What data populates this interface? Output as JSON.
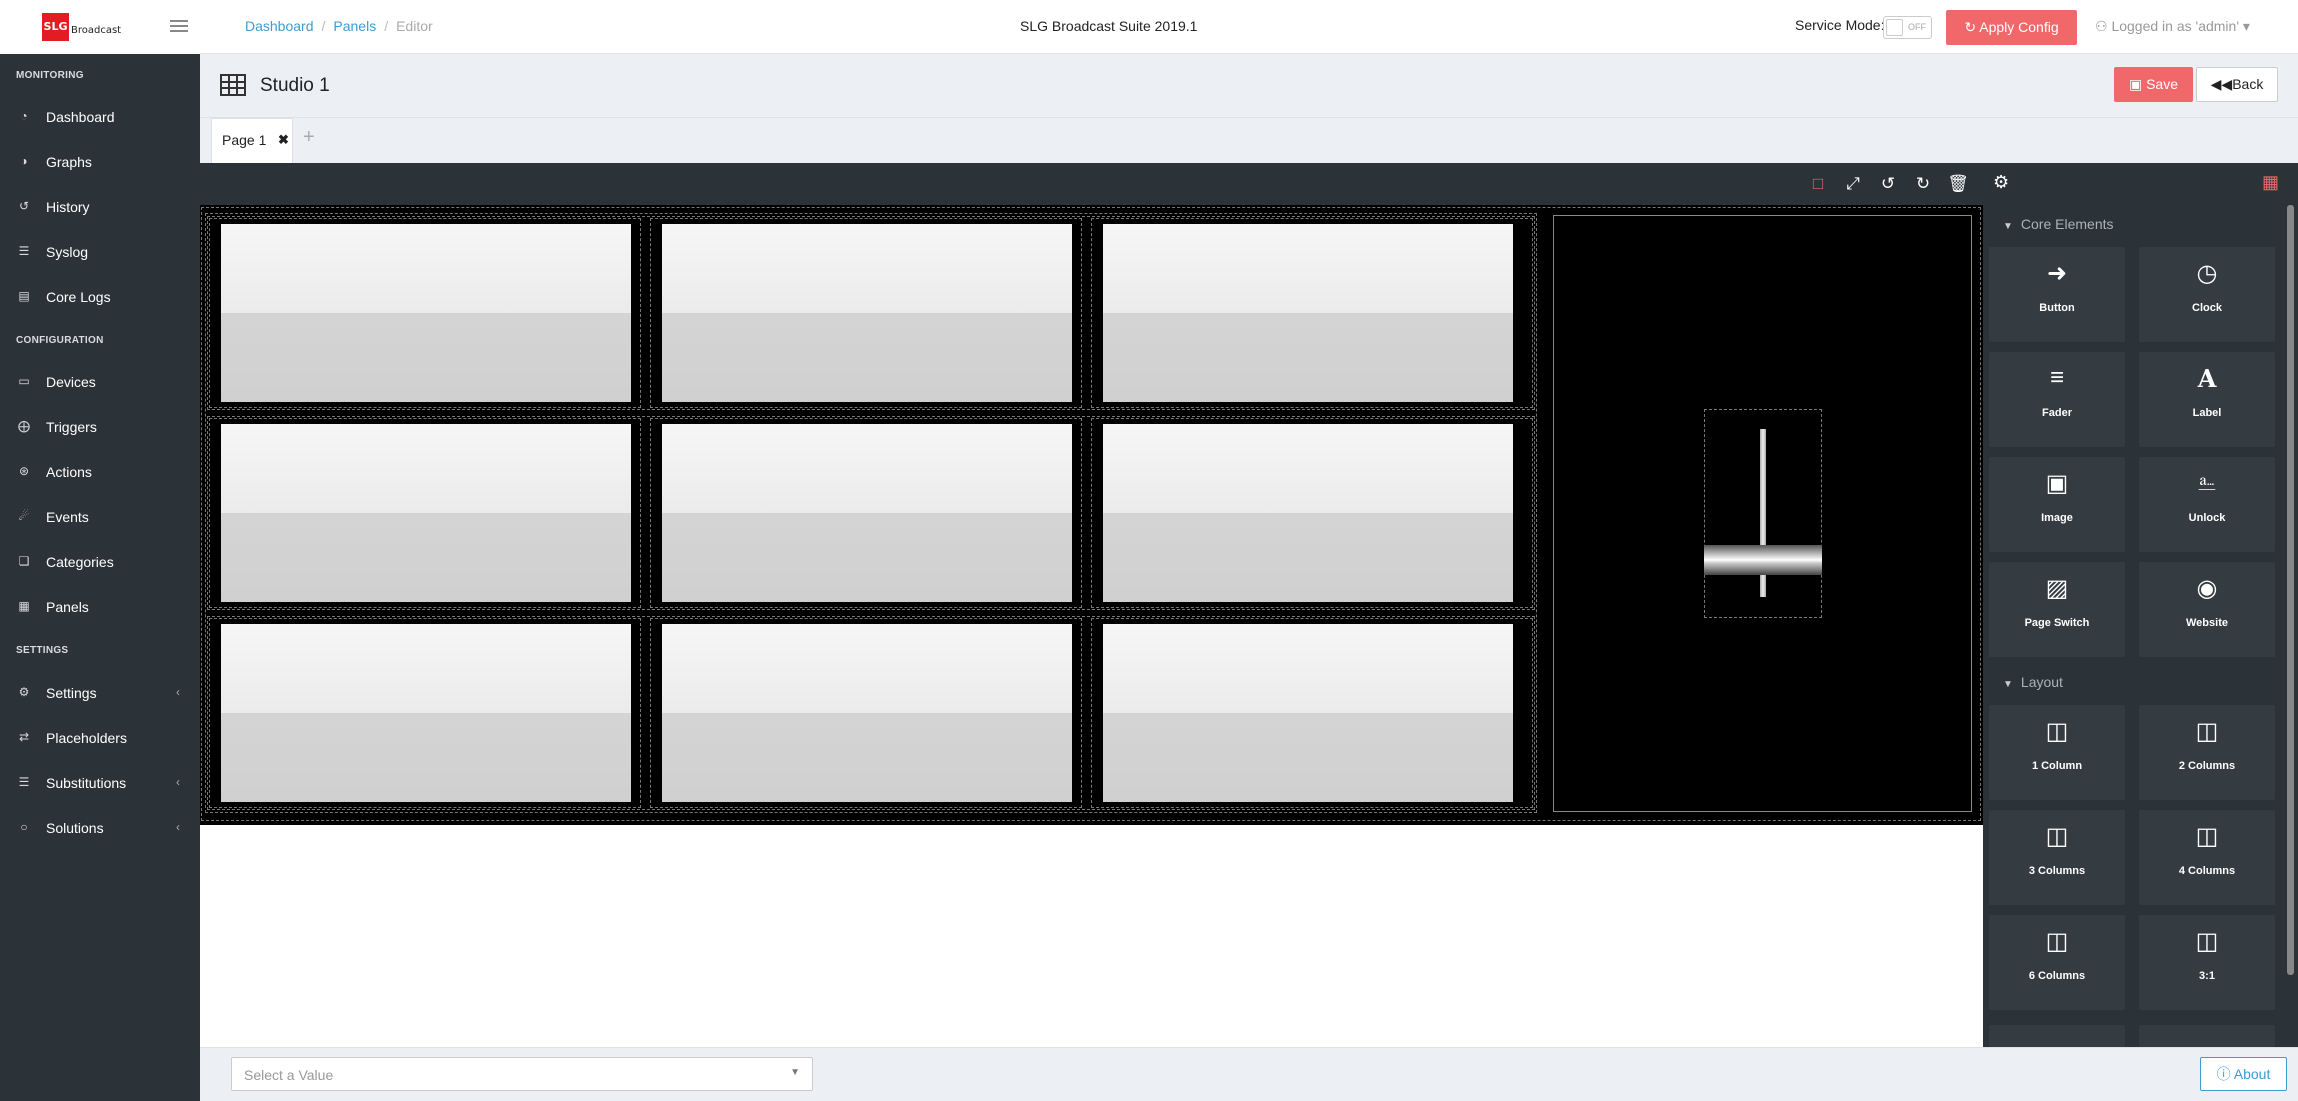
{
  "topbar": {
    "logo_badge": "SLG",
    "logo_word": "Broadcast",
    "breadcrumb": [
      "Dashboard",
      "Panels",
      "Editor"
    ],
    "app_title": "SLG Broadcast Suite 2019.1",
    "service_mode_label": "Service Mode:",
    "service_mode_state": "OFF",
    "apply_config": "Apply Config",
    "user": "Logged in as 'admin'"
  },
  "sidebar": {
    "sections": [
      "MONITORING",
      "CONFIGURATION",
      "SETTINGS"
    ],
    "monitoring": [
      {
        "label": "Dashboard",
        "icon": "dashboard-icon"
      },
      {
        "label": "Graphs",
        "icon": "pie-chart-icon"
      },
      {
        "label": "History",
        "icon": "history-icon"
      },
      {
        "label": "Syslog",
        "icon": "database-icon"
      },
      {
        "label": "Core Logs",
        "icon": "file-icon"
      }
    ],
    "configuration": [
      {
        "label": "Devices",
        "icon": "monitor-icon"
      },
      {
        "label": "Triggers",
        "icon": "crosshair-icon"
      },
      {
        "label": "Actions",
        "icon": "broadcast-icon"
      },
      {
        "label": "Events",
        "icon": "bell-icon"
      },
      {
        "label": "Categories",
        "icon": "cubes-icon"
      },
      {
        "label": "Panels",
        "icon": "grid-icon"
      }
    ],
    "settings": [
      {
        "label": "Settings",
        "icon": "gear-icon",
        "has_children": true
      },
      {
        "label": "Placeholders",
        "icon": "swap-icon",
        "has_children": false
      },
      {
        "label": "Substitutions",
        "icon": "layers-icon",
        "has_children": true
      },
      {
        "label": "Solutions",
        "icon": "lightbulb-icon",
        "has_children": true
      }
    ]
  },
  "header": {
    "title": "Studio 1",
    "save": "Save",
    "back": "Back"
  },
  "tabs": [
    {
      "label": "Page 1"
    }
  ],
  "right_panel": {
    "core_title": "Core Elements",
    "core": [
      {
        "label": "Button",
        "icon": "sign-in-icon"
      },
      {
        "label": "Clock",
        "icon": "clock-icon"
      },
      {
        "label": "Fader",
        "icon": "sliders-icon"
      },
      {
        "label": "Label",
        "icon": "font-icon"
      },
      {
        "label": "Image",
        "icon": "image-icon"
      },
      {
        "label": "Unlock",
        "icon": "unlock-icon"
      },
      {
        "label": "Page Switch",
        "icon": "sticky-note-icon"
      },
      {
        "label": "Website",
        "icon": "globe-icon"
      }
    ],
    "layout_title": "Layout",
    "layout": [
      {
        "label": "1 Column",
        "icon": "columns-icon"
      },
      {
        "label": "2 Columns",
        "icon": "columns-icon"
      },
      {
        "label": "3 Columns",
        "icon": "columns-icon"
      },
      {
        "label": "4 Columns",
        "icon": "columns-icon"
      },
      {
        "label": "6 Columns",
        "icon": "columns-icon"
      },
      {
        "label": "3:1",
        "icon": "columns-icon"
      }
    ]
  },
  "footer": {
    "select_placeholder": "Select a Value",
    "about": "About"
  },
  "colors": {
    "accent": "#f0686a",
    "link": "#3c9dd1",
    "sidebar": "#2c3338"
  }
}
